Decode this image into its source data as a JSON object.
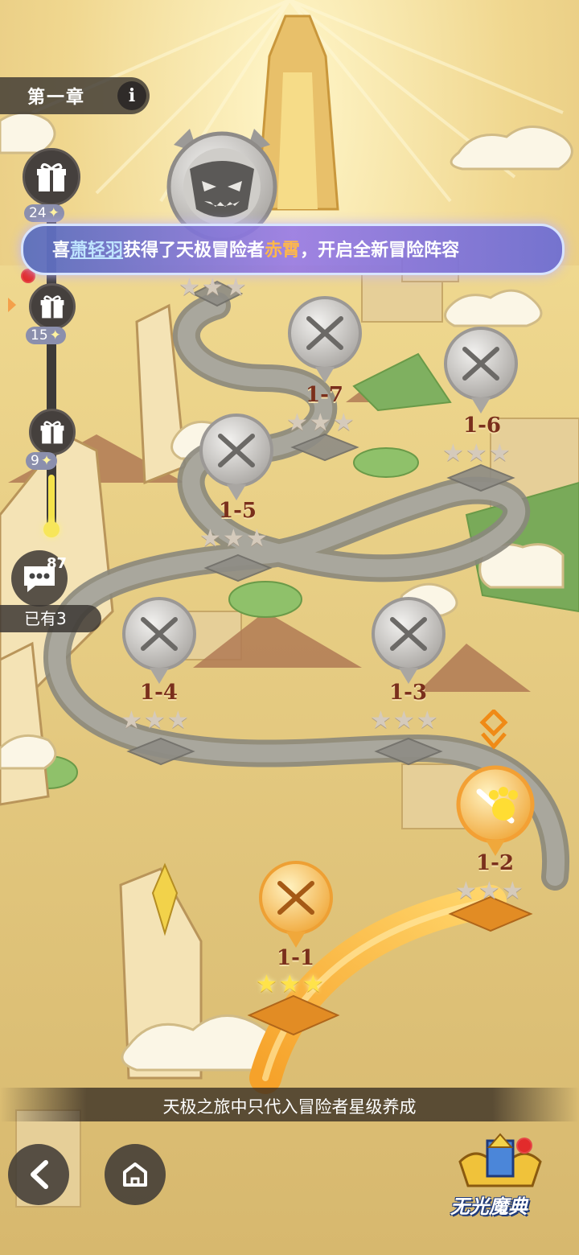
{
  "chapter": {
    "title": "第一章",
    "info_icon_text": "i"
  },
  "rewards_track": {
    "items": [
      {
        "badge": "24",
        "icon": "gift-icon"
      },
      {
        "badge": "15",
        "icon": "gift-icon"
      },
      {
        "badge": "9",
        "icon": "gift-icon"
      }
    ],
    "star_glyph": "✦"
  },
  "banner": {
    "prefix": "喜",
    "player": "萧轻羽",
    "middle": "获得了天极冒险者",
    "hero": "赤霄",
    "suffix": "，开启全新冒险阵容"
  },
  "stages": [
    {
      "id": "boss",
      "label": "",
      "stars_earned": 0,
      "state": "locked",
      "icon": "demon-face-icon"
    },
    {
      "id": "1-7",
      "label": "1-7",
      "stars_earned": 0,
      "state": "locked",
      "icon": "crossed-swords-icon"
    },
    {
      "id": "1-6",
      "label": "1-6",
      "stars_earned": 0,
      "state": "locked",
      "icon": "crossed-swords-icon"
    },
    {
      "id": "1-5",
      "label": "1-5",
      "stars_earned": 0,
      "state": "locked",
      "icon": "crossed-swords-icon"
    },
    {
      "id": "1-4",
      "label": "1-4",
      "stars_earned": 0,
      "state": "locked",
      "icon": "crossed-swords-icon"
    },
    {
      "id": "1-3",
      "label": "1-3",
      "stars_earned": 0,
      "state": "locked",
      "icon": "crossed-swords-icon"
    },
    {
      "id": "1-2",
      "label": "1-2",
      "stars_earned": 0,
      "state": "current",
      "icon": "paw-swords-icon"
    },
    {
      "id": "1-1",
      "label": "1-1",
      "stars_earned": 3,
      "state": "cleared",
      "icon": "crossed-swords-icon"
    }
  ],
  "chat": {
    "count": "87",
    "owned_label": "已有3"
  },
  "hint": "天极之旅中只代入冒险者星级养成",
  "grimoire": {
    "label": "无光魔典"
  },
  "colors": {
    "sand": "#e9cf87",
    "road": "#9c9a8e",
    "gold_road": "#f2a93a",
    "locked_badge": "#b9b6b3",
    "active_badge": "#f5b546",
    "stage_label": "#7a2f1c"
  }
}
